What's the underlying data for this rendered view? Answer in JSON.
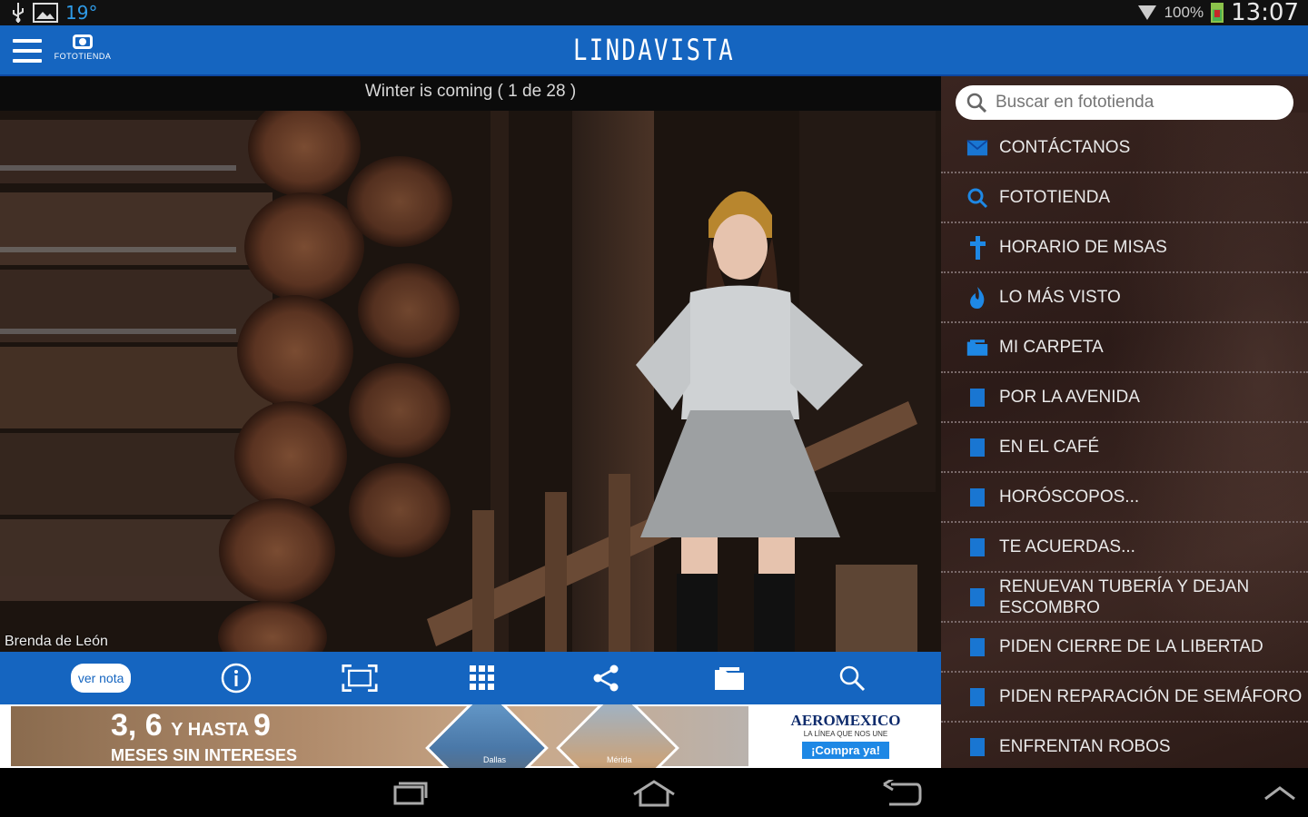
{
  "status_bar": {
    "temperature": "19°",
    "battery": "100%",
    "time": "13:07"
  },
  "app_bar": {
    "logo_label": "FOTOTIENDA",
    "title": "LINDAVISTA"
  },
  "viewer": {
    "caption": "Winter is coming ( 1 de 28 )",
    "credit": "Brenda de León"
  },
  "toolbar": {
    "ver_nota": "ver nota",
    "icons": [
      "info-icon",
      "fullscreen-icon",
      "grid-icon",
      "share-icon",
      "folder-icon",
      "search-icon"
    ]
  },
  "ad": {
    "headline_a": "3, 6 ",
    "headline_b": "Y HASTA ",
    "headline_c": "9",
    "subline": "MESES SIN INTERESES",
    "city_1": "Dallas",
    "city_2": "Mérida",
    "brand": "AEROMEXICO",
    "brand_tagline": "LA LÍNEA QUE NOS UNE",
    "cta": "¡Compra ya!"
  },
  "side_menu": {
    "search_placeholder": "Buscar en fototienda",
    "items": [
      {
        "label": "CONTÁCTANOS",
        "icon": "mail-icon"
      },
      {
        "label": "FOTOTIENDA",
        "icon": "search-icon"
      },
      {
        "label": "HORARIO DE MISAS",
        "icon": "cross-icon"
      },
      {
        "label": "LO MÁS VISTO",
        "icon": "flame-icon"
      },
      {
        "label": "MI CARPETA",
        "icon": "folder-icon"
      },
      {
        "label": "POR LA AVENIDA",
        "icon": "document-icon"
      },
      {
        "label": "EN EL CAFÉ",
        "icon": "document-icon"
      },
      {
        "label": "HORÓSCOPOS...",
        "icon": "document-icon"
      },
      {
        "label": "TE ACUERDAS...",
        "icon": "document-icon"
      },
      {
        "label": "RENUEVAN TUBERÍA Y DEJAN ESCOMBRO",
        "icon": "document-icon"
      },
      {
        "label": "PIDEN CIERRE DE LA LIBERTAD",
        "icon": "document-icon"
      },
      {
        "label": "PIDEN REPARACIÓN DE SEMÁFORO",
        "icon": "document-icon"
      },
      {
        "label": "ENFRENTAN ROBOS",
        "icon": "document-icon"
      }
    ]
  },
  "colors": {
    "accent_blue": "#1565c0",
    "menu_bg": "#2c1b18"
  }
}
